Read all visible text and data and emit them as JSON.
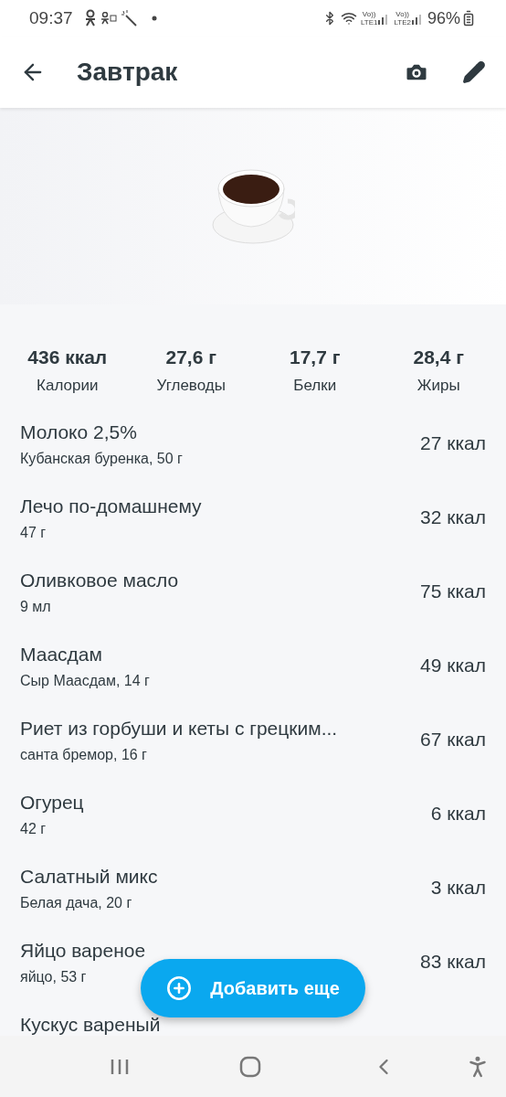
{
  "status_bar": {
    "time": "09:37",
    "sims": [
      {
        "top": "Vo))",
        "bottom": "LTE1"
      },
      {
        "top": "Vo))",
        "bottom": "LTE2"
      }
    ],
    "battery": "96%"
  },
  "app_bar": {
    "title": "Завтрак"
  },
  "summary": [
    {
      "value": "436 ккал",
      "label": "Калории"
    },
    {
      "value": "27,6 г",
      "label": "Углеводы"
    },
    {
      "value": "17,7 г",
      "label": "Белки"
    },
    {
      "value": "28,4 г",
      "label": "Жиры"
    }
  ],
  "items": [
    {
      "name": "Молоко 2,5%",
      "detail": "Кубанская буренка, 50 г",
      "kcal": "27 ккал"
    },
    {
      "name": "Лечо по-домашнему",
      "detail": "47 г",
      "kcal": "32 ккал"
    },
    {
      "name": "Оливковое масло",
      "detail": "9 мл",
      "kcal": "75 ккал"
    },
    {
      "name": "Маасдам",
      "detail": "Сыр Маасдам, 14 г",
      "kcal": "49 ккал"
    },
    {
      "name": "Риет из горбуши и кеты с грецким...",
      "detail": "санта бремор, 16 г",
      "kcal": "67 ккал"
    },
    {
      "name": "Огурец",
      "detail": "42 г",
      "kcal": "6 ккал"
    },
    {
      "name": "Салатный микс",
      "detail": "Белая дача, 20 г",
      "kcal": "3 ккал"
    },
    {
      "name": "Яйцо вареное",
      "detail": "яйцо, 53 г",
      "kcal": "83 ккал"
    },
    {
      "name": "Кускус вареный"
    }
  ],
  "fab": {
    "label": "Добавить еще"
  }
}
